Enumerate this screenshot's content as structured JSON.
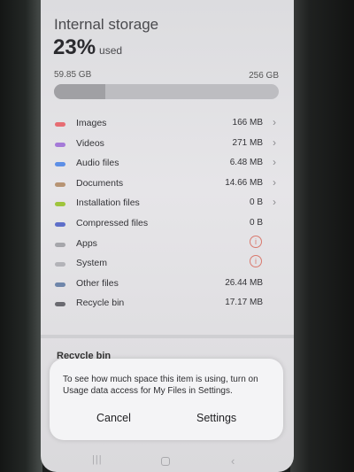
{
  "storage": {
    "title": "Internal storage",
    "percent": "23%",
    "used_label": "used",
    "used_size": "59.85 GB",
    "total_size": "256 GB",
    "used_fraction": 0.23
  },
  "categories": [
    {
      "label": "Images",
      "value": "166 MB",
      "color": "#e76d73",
      "trailing": "chevron"
    },
    {
      "label": "Videos",
      "value": "271 MB",
      "color": "#a57ad8",
      "trailing": "chevron"
    },
    {
      "label": "Audio files",
      "value": "6.48 MB",
      "color": "#5d8fe6",
      "trailing": "chevron"
    },
    {
      "label": "Documents",
      "value": "14.66 MB",
      "color": "#b79474",
      "trailing": "chevron"
    },
    {
      "label": "Installation files",
      "value": "0 B",
      "color": "#9fc43d",
      "trailing": "chevron"
    },
    {
      "label": "Compressed files",
      "value": "0 B",
      "color": "#5e6fc9",
      "trailing": "none"
    },
    {
      "label": "Apps",
      "value": "",
      "color": "#a6a6ab",
      "trailing": "info"
    },
    {
      "label": "System",
      "value": "",
      "color": "#b3b3b8",
      "trailing": "info"
    },
    {
      "label": "Other files",
      "value": "26.44 MB",
      "color": "#6f86aa",
      "trailing": "none"
    },
    {
      "label": "Recycle bin",
      "value": "17.17 MB",
      "color": "#6a6a70",
      "trailing": "none"
    }
  ],
  "section_heading": "Recycle bin",
  "dialog": {
    "message": "To see how much space this item is using, turn on Usage data access for My Files in Settings.",
    "cancel_label": "Cancel",
    "settings_label": "Settings"
  },
  "icons": {
    "chevron": "›",
    "info": "i",
    "recents": "|||",
    "back": "‹"
  }
}
